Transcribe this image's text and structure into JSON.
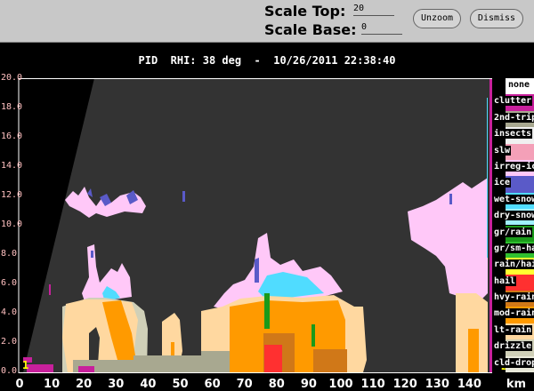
{
  "controls": {
    "scale_top_label": "Scale Top:",
    "scale_top_value": "20",
    "scale_base_label": "Scale Base:",
    "scale_base_value": "0",
    "unzoom": "Unzoom",
    "dismiss": "Dismiss"
  },
  "title": "PID  RHI: 38 deg  -  10/26/2011 22:38:40",
  "y_axis": {
    "ticks": [
      "20.0",
      "18.0",
      "16.0",
      "14.0",
      "12.0",
      "10.0",
      "8.0",
      "6.0",
      "4.0",
      "2.0",
      "0.0"
    ]
  },
  "x_axis": {
    "ticks": [
      "0",
      "10",
      "20",
      "30",
      "40",
      "50",
      "60",
      "70",
      "80",
      "90",
      "100",
      "110",
      "120",
      "130",
      "140"
    ],
    "unit": "km"
  },
  "markers": {
    "left": "1",
    "right": "2"
  },
  "legend": [
    {
      "label": "none",
      "color": "#ffffff"
    },
    {
      "label": "clutter",
      "color": "#c8209c"
    },
    {
      "label": "2nd-trip",
      "color": "#a8a890"
    },
    {
      "label": "insects",
      "color": "#f0f0f0"
    },
    {
      "label": "slw",
      "color": "#f4a0b8"
    },
    {
      "label": "irreg-ice",
      "color": "#ffc8f8"
    },
    {
      "label": "ice",
      "color": "#5a5ac8"
    },
    {
      "label": "wet-snow",
      "color": "#50dcff"
    },
    {
      "label": "dry-snow",
      "color": "#a0f0ff"
    },
    {
      "label": "gr/rain",
      "color": "#1a9a1a"
    },
    {
      "label": "gr/sm-hail",
      "color": "#30c030"
    },
    {
      "label": "rain/hail",
      "color": "#ffff30"
    },
    {
      "label": "hail",
      "color": "#ff3030"
    },
    {
      "label": "hvy-rain",
      "color": "#d07818"
    },
    {
      "label": "mod-rain",
      "color": "#ff9a00"
    },
    {
      "label": "lt-rain",
      "color": "#ffd8a0"
    },
    {
      "label": "drizzle",
      "color": "#d0d0b8"
    },
    {
      "label": "cld-drop",
      "color": "#e8e8d8"
    }
  ]
}
